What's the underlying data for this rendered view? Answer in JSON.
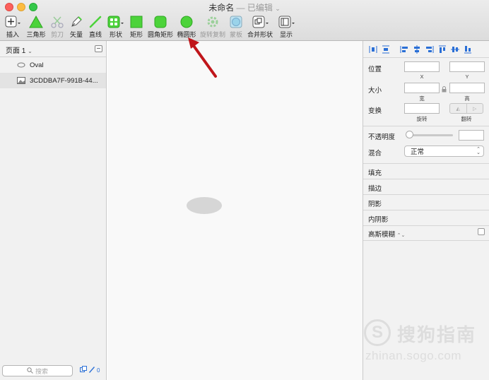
{
  "window": {
    "title": "未命名",
    "title_sep": " — ",
    "title_status": "已编辑"
  },
  "toolbar": {
    "insert": "插入",
    "triangle": "三角形",
    "scissors": "剪刀",
    "vector": "矢量",
    "line": "直线",
    "shapes": "形状",
    "rectangle": "矩形",
    "rounded_rect": "圆角矩形",
    "ellipse": "椭圆形",
    "rotate_copy": "旋转复制",
    "mask": "蒙板",
    "combine": "合并形状",
    "display": "显示"
  },
  "colors": {
    "shape_green": "#4cd33a",
    "annotation_arrow": "#c0161b"
  },
  "pages": {
    "current": "页面 1"
  },
  "layers": [
    {
      "name": "Oval",
      "icon": "oval-icon"
    },
    {
      "name": "3CDDBA7F-991B-44...",
      "icon": "image-icon"
    }
  ],
  "search": {
    "placeholder": "搜索"
  },
  "layers_count": "0",
  "inspector": {
    "position": "位置",
    "x": "X",
    "y": "Y",
    "size": "大小",
    "width": "宽",
    "height": "高",
    "transform": "变换",
    "rotate": "旋转",
    "flip": "翻转",
    "opacity": "不透明度",
    "opacity_value": 0,
    "blend": "混合",
    "blend_value": "正常",
    "fill": "填充",
    "border": "描边",
    "shadow": "阴影",
    "inner_shadow": "内阴影",
    "gaussian_blur": "高斯模糊"
  },
  "watermark": {
    "brand": "搜狗指南",
    "url": "zhinan.sogo.com",
    "logo_letter": "S"
  }
}
